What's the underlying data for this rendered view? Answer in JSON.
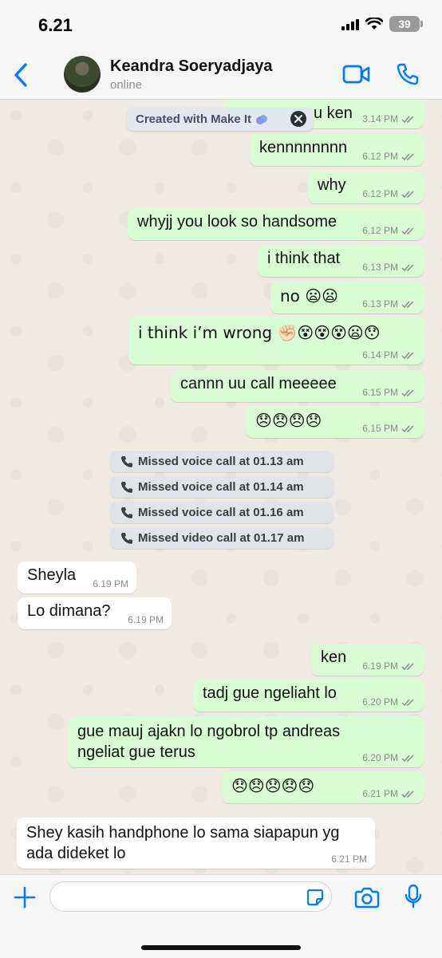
{
  "status_bar": {
    "time": "6.21",
    "battery": "39"
  },
  "header": {
    "contact_name": "Keandra Soeryadjaya",
    "contact_status": "online",
    "icons": [
      "chevron-left-icon",
      "avatar",
      "video-call-icon",
      "phone-icon"
    ]
  },
  "watermark": {
    "text": "Created with Make It"
  },
  "messages": [
    {
      "text": "u ken",
      "time": "3.14 PM"
    },
    {
      "text": "kennnnnnnn",
      "time": "6.12 PM"
    },
    {
      "text": "why",
      "time": "6.12 PM"
    },
    {
      "text": "whyjj you look so handsome",
      "time": "6.12 PM"
    },
    {
      "text": "i think that",
      "time": "6.13 PM"
    },
    {
      "text": "no 😦😦",
      "time": "6.13 PM"
    },
    {
      "text": "i think i’m wrong ✊🏻😵😵😵😦😯",
      "time": "6.14 PM"
    },
    {
      "text": "cannn uu call meeeee",
      "time": "6.15 PM"
    },
    {
      "text": "😞😞😞😞",
      "time": "6.15 PM"
    },
    {
      "text": "Missed voice call at 01.13 am"
    },
    {
      "text": "Missed voice call at 01.14 am"
    },
    {
      "text": "Missed voice call at 01.16 am"
    },
    {
      "text": "Missed video call at 01.17 am"
    },
    {
      "text": "Sheyla",
      "time": "6.19 PM"
    },
    {
      "text": "Lo dimana?",
      "time": "6.19 PM"
    },
    {
      "text": "ken",
      "time": "6.19 PM"
    },
    {
      "text": "tadj gue ngeliaht lo",
      "time": "6.20 PM"
    },
    {
      "text": "gue mauj ajakn lo ngobrol tp andreas ngeliat gue terus",
      "time": "6.20 PM"
    },
    {
      "text": "😞😞😞😞😞",
      "time": "6.21 PM"
    },
    {
      "text": "Shey kasih handphone lo sama siapapun yg ada dideket lo",
      "time": "6.21 PM"
    }
  ],
  "input_bar": {
    "placeholder": ""
  },
  "colors": {
    "accent": "#007aff",
    "outgoing": "#d9fdd3",
    "incoming": "#ffffff",
    "tick": "#8a8a8a"
  }
}
